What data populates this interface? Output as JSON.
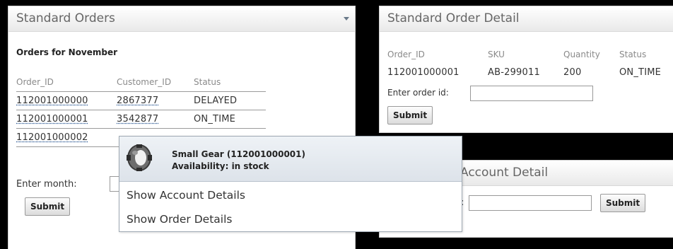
{
  "orders_panel": {
    "title": "Standard Orders",
    "subtitle": "Orders for November",
    "columns": [
      "Order_ID",
      "Customer_ID",
      "Status"
    ],
    "rows": [
      {
        "order_id": "112001000000",
        "customer_id": "2867377",
        "status": "DELAYED"
      },
      {
        "order_id": "112001000001",
        "customer_id": "3542877",
        "status": "ON_TIME"
      },
      {
        "order_id": "112001000002",
        "customer_id": "",
        "status": ""
      }
    ],
    "month_label": "Enter month:",
    "submit_label": "Submit"
  },
  "detail_panel": {
    "title": "Standard Order Detail",
    "columns": [
      "Order_ID",
      "SKU",
      "Quantity",
      "Status"
    ],
    "row": {
      "order_id": "112001000001",
      "sku": "AB-299011",
      "quantity": "200",
      "status": "ON_TIME"
    },
    "order_id_label": "Enter order id:",
    "submit_label": "Submit"
  },
  "account_panel": {
    "title": "Account Detail",
    "field_label": ":",
    "submit_label": "Submit"
  },
  "popup": {
    "product_name": "Small Gear (112001000001)",
    "availability": "Availability: in stock",
    "menu_items": [
      "Show Account Details",
      "Show Order Details"
    ],
    "icon": "gear-icon"
  }
}
